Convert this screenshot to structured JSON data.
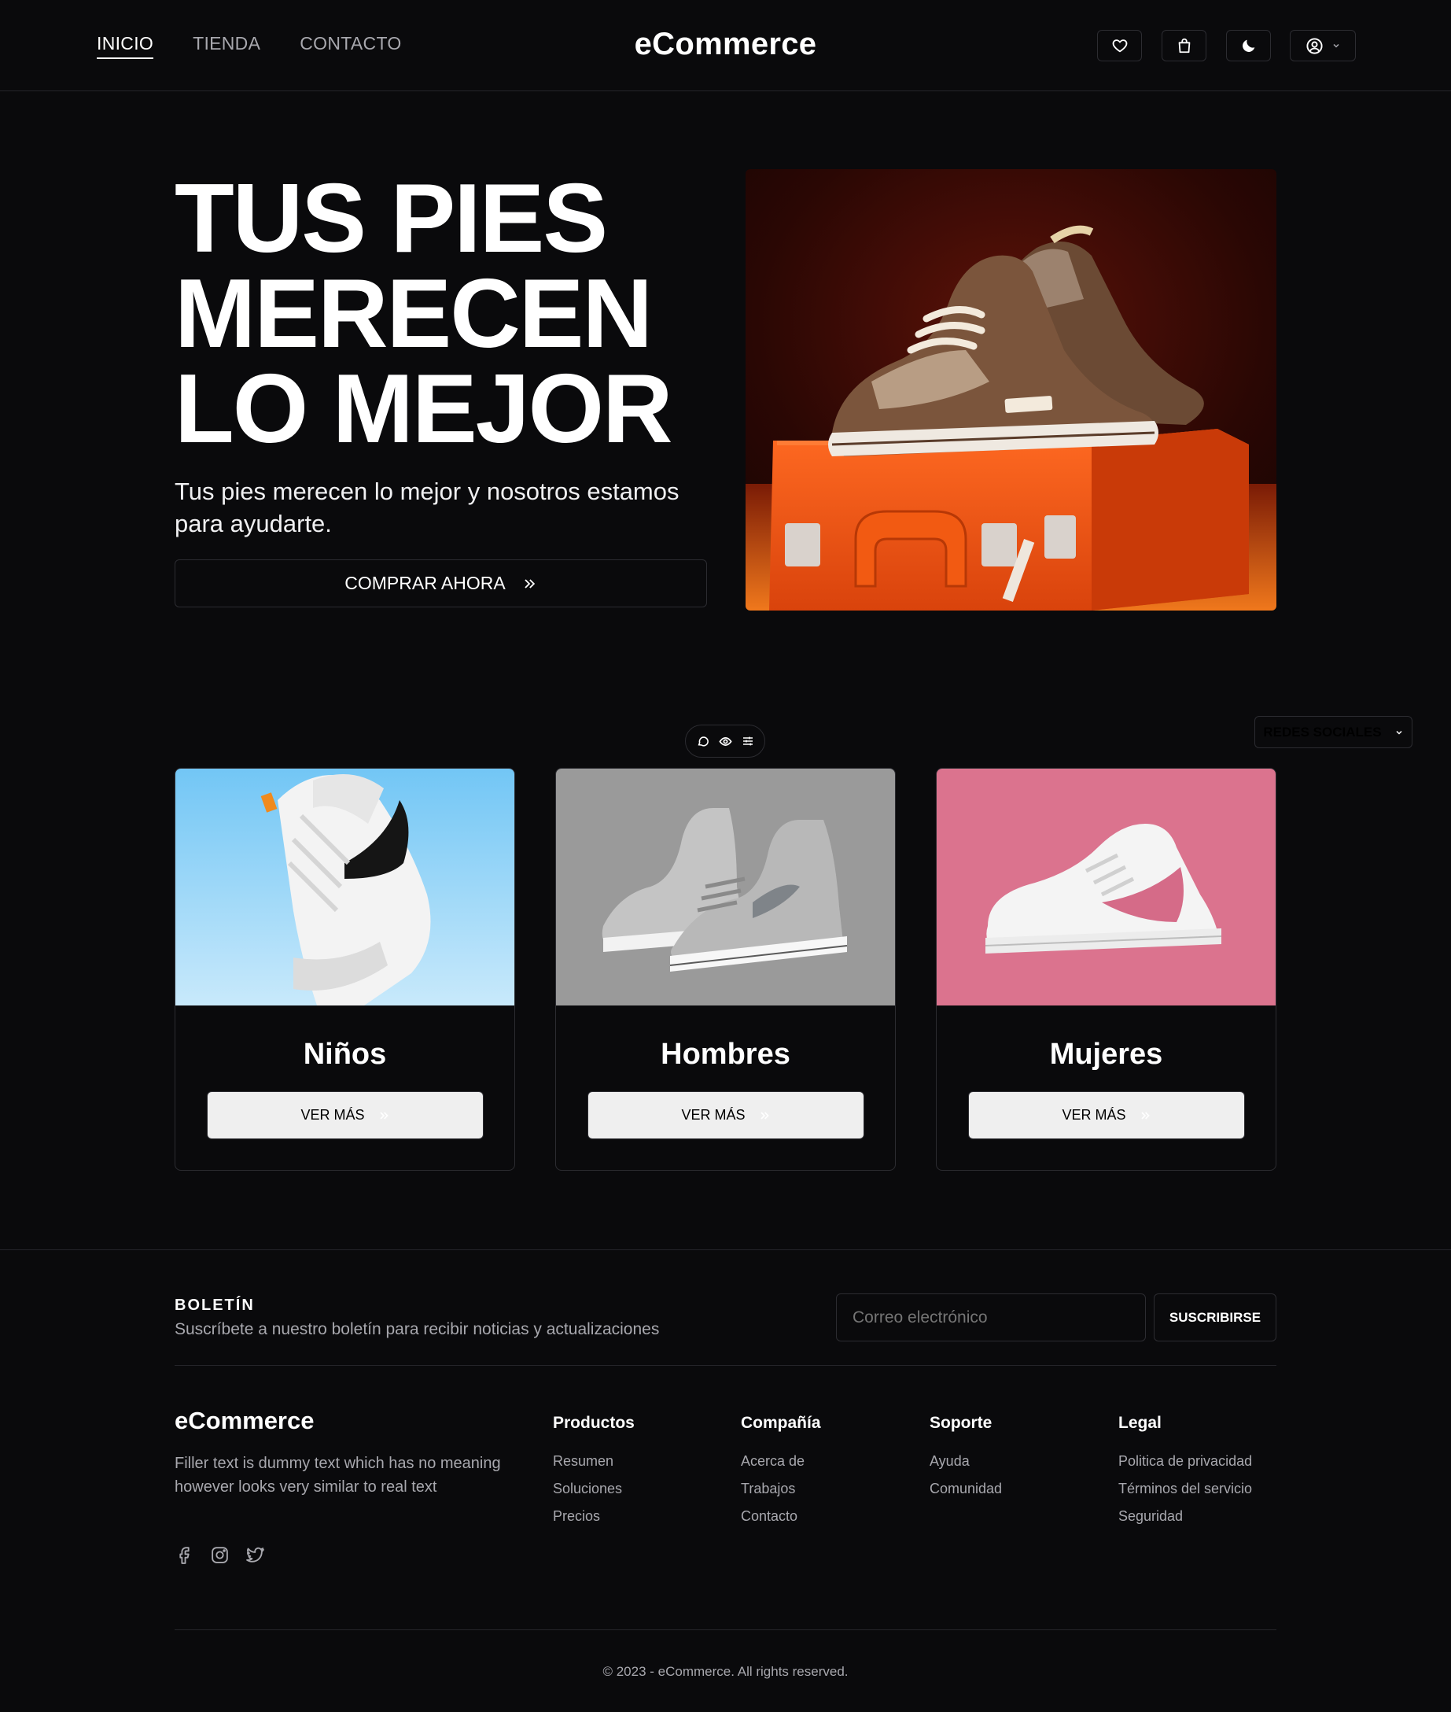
{
  "header": {
    "nav": [
      {
        "label": "INICIO",
        "active": true
      },
      {
        "label": "TIENDA",
        "active": false
      },
      {
        "label": "CONTACTO",
        "active": false
      }
    ],
    "brand": "eCommerce",
    "icons": [
      "heart-icon",
      "shopping-bag-icon",
      "moon-icon",
      "user-circle-icon",
      "chevron-down-icon"
    ]
  },
  "hero": {
    "title_lines": [
      "TUS PIES",
      "MERECEN",
      "LO MEJOR"
    ],
    "subtitle": "Tus pies merecen lo mejor y nosotros estamos para ayudarte.",
    "cta": "COMPRAR AHORA"
  },
  "floating_toolbar": {
    "icons": [
      "chat-icon",
      "eye-icon",
      "sliders-icon"
    ]
  },
  "social_dropdown": {
    "label": "REDES SOCIALES"
  },
  "categories": [
    {
      "title": "Niños",
      "button": "VER MÁS",
      "bg": "#8fcdf3"
    },
    {
      "title": "Hombres",
      "button": "VER MÁS",
      "bg": "#9a9a9a"
    },
    {
      "title": "Mujeres",
      "button": "VER MÁS",
      "bg": "#db738e"
    }
  ],
  "newsletter": {
    "title": "BOLETÍN",
    "description": "Suscríbete a nuestro boletín para recibir noticias y actualizaciones",
    "placeholder": "Correo electrónico",
    "button": "SUSCRIBIRSE"
  },
  "footer": {
    "brand": "eCommerce",
    "description": "Filler text is dummy text which has no meaning however looks very similar to real text",
    "social_icons": [
      "facebook-icon",
      "instagram-icon",
      "twitter-icon"
    ],
    "columns": [
      {
        "title": "Productos",
        "links": [
          "Resumen",
          "Soluciones",
          "Precios"
        ]
      },
      {
        "title": "Compañía",
        "links": [
          "Acerca de",
          "Trabajos",
          "Contacto"
        ]
      },
      {
        "title": "Soporte",
        "links": [
          "Ayuda",
          "Comunidad"
        ]
      },
      {
        "title": "Legal",
        "links": [
          "Politica de privacidad",
          "Términos del servicio",
          "Seguridad"
        ]
      }
    ],
    "copyright": "© 2023 - eCommerce. All rights reserved."
  },
  "colors": {
    "background": "#0a0a0c",
    "border": "#2c2c31",
    "muted_text": "#a8a8ae",
    "hero_orange": "#f05a1a"
  }
}
